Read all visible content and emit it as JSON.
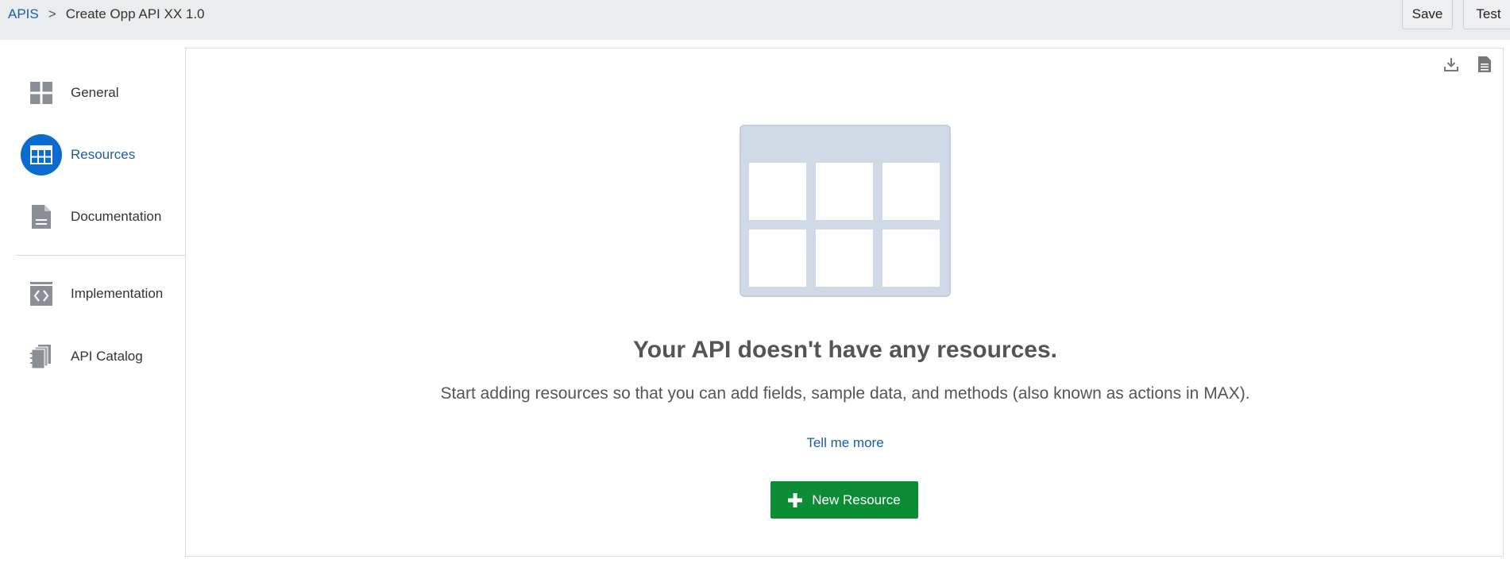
{
  "breadcrumb": {
    "root": "APIS",
    "separator": ">",
    "current": "Create Opp API XX  1.0"
  },
  "toolbar": {
    "save_label": "Save",
    "test_label": "Test"
  },
  "sidebar": {
    "items": [
      {
        "label": "General",
        "icon": "grid-icon",
        "active": false
      },
      {
        "label": "Resources",
        "icon": "table-icon",
        "active": true
      },
      {
        "label": "Documentation",
        "icon": "document-icon",
        "active": false
      },
      {
        "label": "Implementation",
        "icon": "code-icon",
        "active": false
      },
      {
        "label": "API Catalog",
        "icon": "catalog-icon",
        "active": false
      }
    ]
  },
  "panel": {
    "actions": [
      {
        "icon": "download-icon"
      },
      {
        "icon": "document-icon"
      }
    ],
    "empty_state": {
      "title": "Your API doesn't have any resources.",
      "description": "Start adding resources so that you can add fields, sample data, and methods (also known as actions in MAX).",
      "link_label": "Tell me more",
      "button_label": "New Resource"
    }
  },
  "colors": {
    "accent": "#0a6bd0",
    "link": "#1a5ea6",
    "primary_button": "#0b8c35",
    "topbar": "#eaecee",
    "illustration": "#cfdae6"
  }
}
